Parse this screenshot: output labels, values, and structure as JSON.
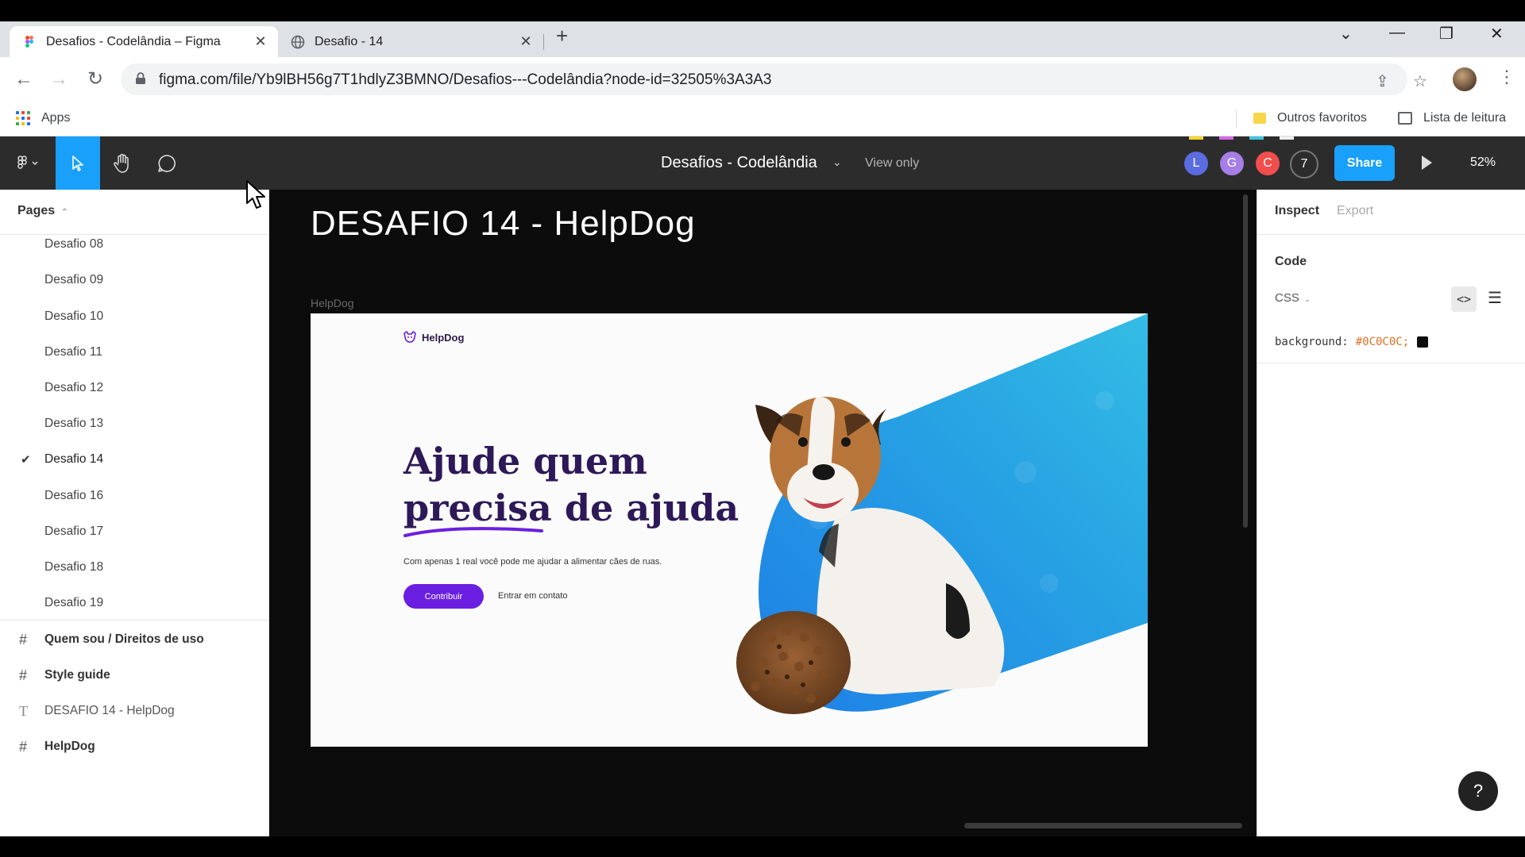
{
  "browser": {
    "tabs": [
      {
        "title": "Desafios - Codelândia – Figma",
        "active": true
      },
      {
        "title": "Desafio - 14",
        "active": false
      }
    ],
    "url": "figma.com/file/Yb9lBH56g7T1hdlyZ3BMNO/Desafios---Codelândia?node-id=32505%3A3A3",
    "bookmarks": {
      "apps": "Apps",
      "others": "Outros favoritos",
      "reading_list": "Lista de leitura"
    }
  },
  "figma": {
    "file_title": "Desafios - Codelândia",
    "mode": "View only",
    "collaborators": [
      {
        "initial": "L",
        "color": "#5b6be0"
      },
      {
        "initial": "G",
        "color": "#a57ee6"
      },
      {
        "initial": "C",
        "color": "#f24e4e"
      }
    ],
    "collaborator_count": "7",
    "share_label": "Share",
    "zoom": "52%",
    "accent_color": "#18a0fb"
  },
  "pages_panel": {
    "header": "Pages",
    "pages": [
      {
        "label": "Desafio 08",
        "current": false
      },
      {
        "label": "Desafio 09",
        "current": false
      },
      {
        "label": "Desafio 10",
        "current": false
      },
      {
        "label": "Desafio 11",
        "current": false
      },
      {
        "label": "Desafio 12",
        "current": false
      },
      {
        "label": "Desafio 13",
        "current": false
      },
      {
        "label": "Desafio 14",
        "current": true
      },
      {
        "label": "Desafio 16",
        "current": false
      },
      {
        "label": "Desafio 17",
        "current": false
      },
      {
        "label": "Desafio 18",
        "current": false
      },
      {
        "label": "Desafio 19",
        "current": false
      }
    ],
    "layers": [
      {
        "label": "Quem sou / Direitos de uso",
        "type": "frame"
      },
      {
        "label": "Style guide",
        "type": "frame"
      },
      {
        "label": "DESAFIO 14 - HelpDog",
        "type": "text"
      },
      {
        "label": "HelpDog",
        "type": "frame"
      }
    ]
  },
  "canvas": {
    "title": "DESAFIO 14 - HelpDog",
    "frame_label": "HelpDog",
    "design": {
      "logo": "HelpDog",
      "headline_line1": "Ajude quem",
      "headline_line2_part1": "precisa",
      "headline_line2_part2": " de ajuda",
      "subtitle": "Com apenas 1 real você pode me ajudar a alimentar cães de ruas.",
      "cta": "Contribuir",
      "secondary_link": "Entrar em contato",
      "brand_color": "#6a1fe0",
      "headline_color": "#2d1958"
    }
  },
  "inspect_panel": {
    "tabs": [
      "Inspect",
      "Export"
    ],
    "section_title": "Code",
    "language": "CSS",
    "css_property": "background:",
    "css_value": "#0C0C0C;",
    "help": "?"
  }
}
